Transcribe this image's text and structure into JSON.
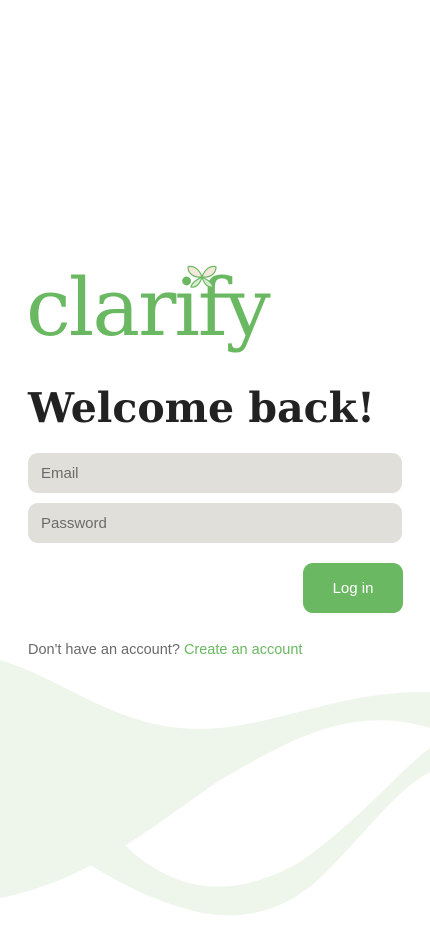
{
  "brand": {
    "name": "clarify",
    "color": "#6bb862",
    "logo_icon": "butterfly-leaf-icon"
  },
  "heading": "Welcome back!",
  "form": {
    "email_placeholder": "Email",
    "password_placeholder": "Password",
    "login_label": "Log in"
  },
  "signup": {
    "prompt": "Don't have an account?",
    "link_label": "Create an account"
  },
  "colors": {
    "field_bg": "#e0dfda",
    "wave": "#eef5ea",
    "heading": "#222222"
  }
}
